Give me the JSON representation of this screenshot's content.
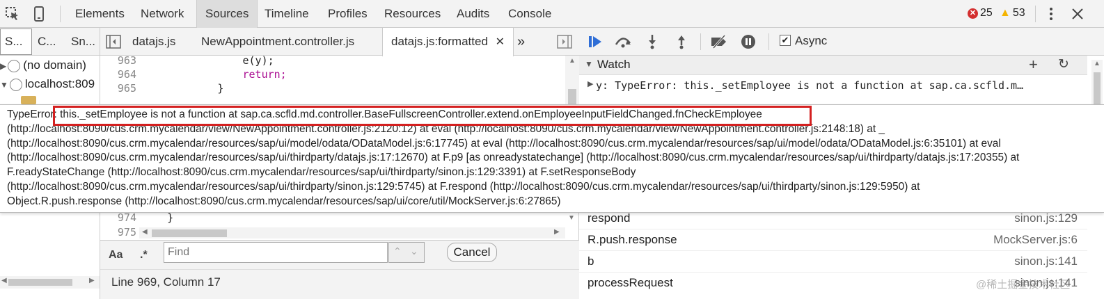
{
  "toolbar": {
    "tabs": [
      "Elements",
      "Network",
      "Sources",
      "Timeline",
      "Profiles",
      "Resources",
      "Audits",
      "Console"
    ],
    "active_tab": "Sources",
    "errors": "25",
    "warnings": "53"
  },
  "navigator": {
    "tabs": [
      "S...",
      "C...",
      "Sn..."
    ],
    "tree": [
      {
        "label": "(no domain)"
      },
      {
        "label": "localhost:809"
      }
    ]
  },
  "editor": {
    "tabs": [
      "datajs.js",
      "NewAppointment.controller.js",
      "datajs.js:formatted"
    ],
    "more": "»",
    "lines": [
      {
        "num": "963",
        "text": "                e(y);"
      },
      {
        "num": "964",
        "text": "                return;"
      },
      {
        "num": "965",
        "text": "            }"
      },
      {
        "num": "974",
        "text": "    }"
      },
      {
        "num": "975",
        "text": ""
      }
    ],
    "search": {
      "case_label": "Aa",
      "regex_label": ".*",
      "placeholder": "Find",
      "cancel": "Cancel"
    },
    "status": "Line 969, Column 17"
  },
  "debugger": {
    "async_label": "Async",
    "watch_title": "Watch",
    "watch_expr": "y: TypeError: this._setEmployee is not a function at sap.ca.scfld.m…",
    "call_stack": [
      {
        "fn": "respond",
        "loc": "sinon.js:129"
      },
      {
        "fn": "R.push.response",
        "loc": "MockServer.js:6"
      },
      {
        "fn": "b",
        "loc": "sinon.js:141"
      },
      {
        "fn": "processRequest",
        "loc": "sinon.js:141"
      }
    ],
    "watermark": "@稀土掘金技术社区"
  },
  "tooltip": {
    "lines": [
      "TypeError: this._setEmployee is not a function at sap.ca.scfld.md.controller.BaseFullscreenController.extend.onEmployeeInputFieldChanged.fnCheckEmployee",
      "(http://localhost:8090/cus.crm.mycalendar/view/NewAppointment.controller.js:2120:12) at eval (http://localhost:8090/cus.crm.mycalendar/view/NewAppointment.controller.js:2148:18) at _",
      "(http://localhost:8090/cus.crm.mycalendar/resources/sap/ui/model/odata/ODataModel.js:6:17745) at eval (http://localhost:8090/cus.crm.mycalendar/resources/sap/ui/model/odata/ODataModel.js:6:35101) at eval",
      "(http://localhost:8090/cus.crm.mycalendar/resources/sap/ui/thirdparty/datajs.js:17:12670) at F.p9 [as onreadystatechange] (http://localhost:8090/cus.crm.mycalendar/resources/sap/ui/thirdparty/datajs.js:17:20355) at",
      "F.readyStateChange (http://localhost:8090/cus.crm.mycalendar/resources/sap/ui/thirdparty/sinon.js:129:3391) at F.setResponseBody",
      "(http://localhost:8090/cus.crm.mycalendar/resources/sap/ui/thirdparty/sinon.js:129:5745) at F.respond (http://localhost:8090/cus.crm.mycalendar/resources/sap/ui/thirdparty/sinon.js:129:5950) at",
      "Object.R.push.response (http://localhost:8090/cus.crm.mycalendar/resources/sap/ui/core/util/MockServer.js:6:27865)"
    ]
  },
  "colors": {
    "highlight": "#d42020",
    "error": "#d32f2f",
    "warning": "#f4b400",
    "accent": "#2f6ed6"
  }
}
